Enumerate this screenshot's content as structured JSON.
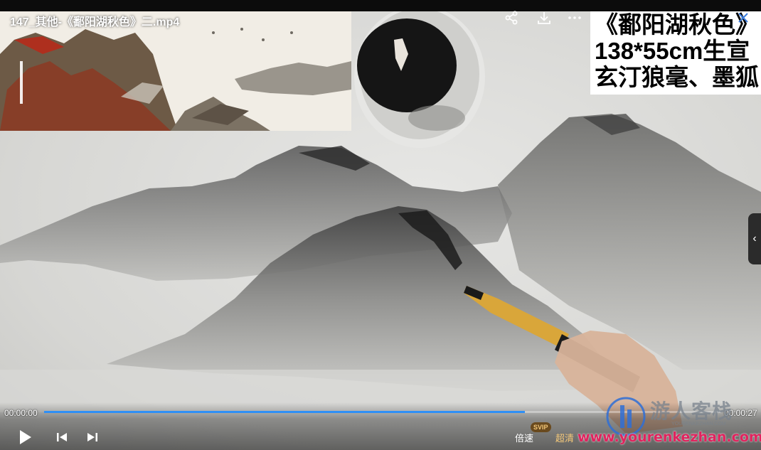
{
  "video": {
    "title": "147_其他-《鄱阳湖秋色》二.mp4",
    "current_time": "00:00:00",
    "duration": "00:00:27",
    "progress": 0.71
  },
  "caption": {
    "line1": "《鄱阳湖秋色》",
    "line2": "138*55cm生宣",
    "line3": "玄汀狼毫、墨狐"
  },
  "top_actions": {
    "share_icon": "share-icon",
    "download_icon": "download-icon",
    "more_icon": "more-icon",
    "close_icon": "close-icon"
  },
  "controls": {
    "speed_label": "倍速",
    "quality_label": "超清",
    "svip_badge": "SVIP",
    "play_icon": "play-icon",
    "prev_icon": "previous-icon",
    "next_icon": "next-icon"
  },
  "watermark": {
    "name": "游人客栈",
    "sub": "YOURENKEZHAN.COM",
    "url": "www.yourenkezhan.com"
  },
  "colors": {
    "progress": "#2f8ff5",
    "watermark_url": "#e0245e"
  }
}
